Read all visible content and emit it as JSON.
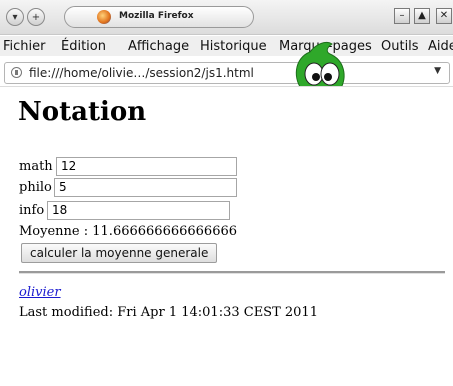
{
  "window": {
    "tab_title": "Mozilla Firefox",
    "nav_buttons": [
      "▾",
      "+"
    ],
    "controls": [
      "–",
      "▲",
      "✕"
    ]
  },
  "menubar": {
    "items": [
      "Fichier",
      "Édition",
      "Affichage",
      "Historique",
      "Marque-pages",
      "Outils",
      "Aide"
    ]
  },
  "urlbar": {
    "url": "file:///home/olivie…/session2/js1.html",
    "dropdown": "▼"
  },
  "page": {
    "heading": "Notation",
    "fields": [
      {
        "label": "math",
        "value": "12"
      },
      {
        "label": "philo",
        "value": "5"
      },
      {
        "label": "info",
        "value": "18"
      }
    ],
    "average_label": "Moyenne : ",
    "average_value": "11.666666666666666",
    "button_label": "calculer la moyenne generale",
    "author_link": "olivier",
    "last_modified": "Last modified: Fri Apr 1 14:01:33 CEST 2011"
  },
  "colors": {
    "link": "#1a1ad0",
    "mascot": "#2fa82a"
  }
}
